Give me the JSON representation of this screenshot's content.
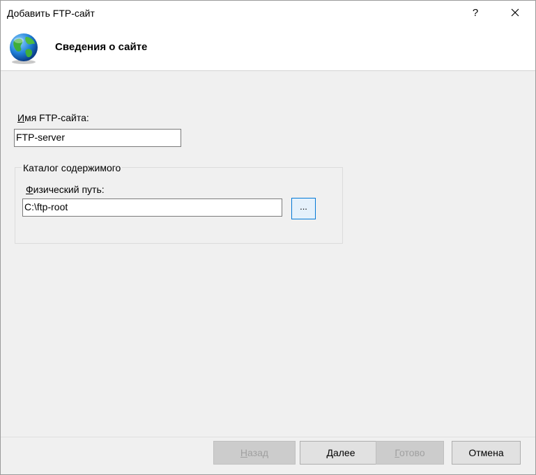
{
  "window": {
    "title": "Добавить FTP-сайт",
    "help_label": "?",
    "close_icon": "close-icon"
  },
  "header": {
    "icon": "globe-icon",
    "title": "Сведения о сайте"
  },
  "site_name": {
    "label_first": "И",
    "label_rest": "мя FTP-сайта:",
    "value": "FTP-server"
  },
  "content_group": {
    "legend": "Каталог содержимого",
    "path_label_first": "Ф",
    "path_label_rest": "изический путь:",
    "path_value": "C:\\ftp-root",
    "browse_label": "..."
  },
  "buttons": {
    "back_first": "Н",
    "back_rest": "азад",
    "next_first": "Д",
    "next_rest": "алее",
    "finish_first": "Г",
    "finish_rest": "отово",
    "cancel": "Отмена"
  }
}
